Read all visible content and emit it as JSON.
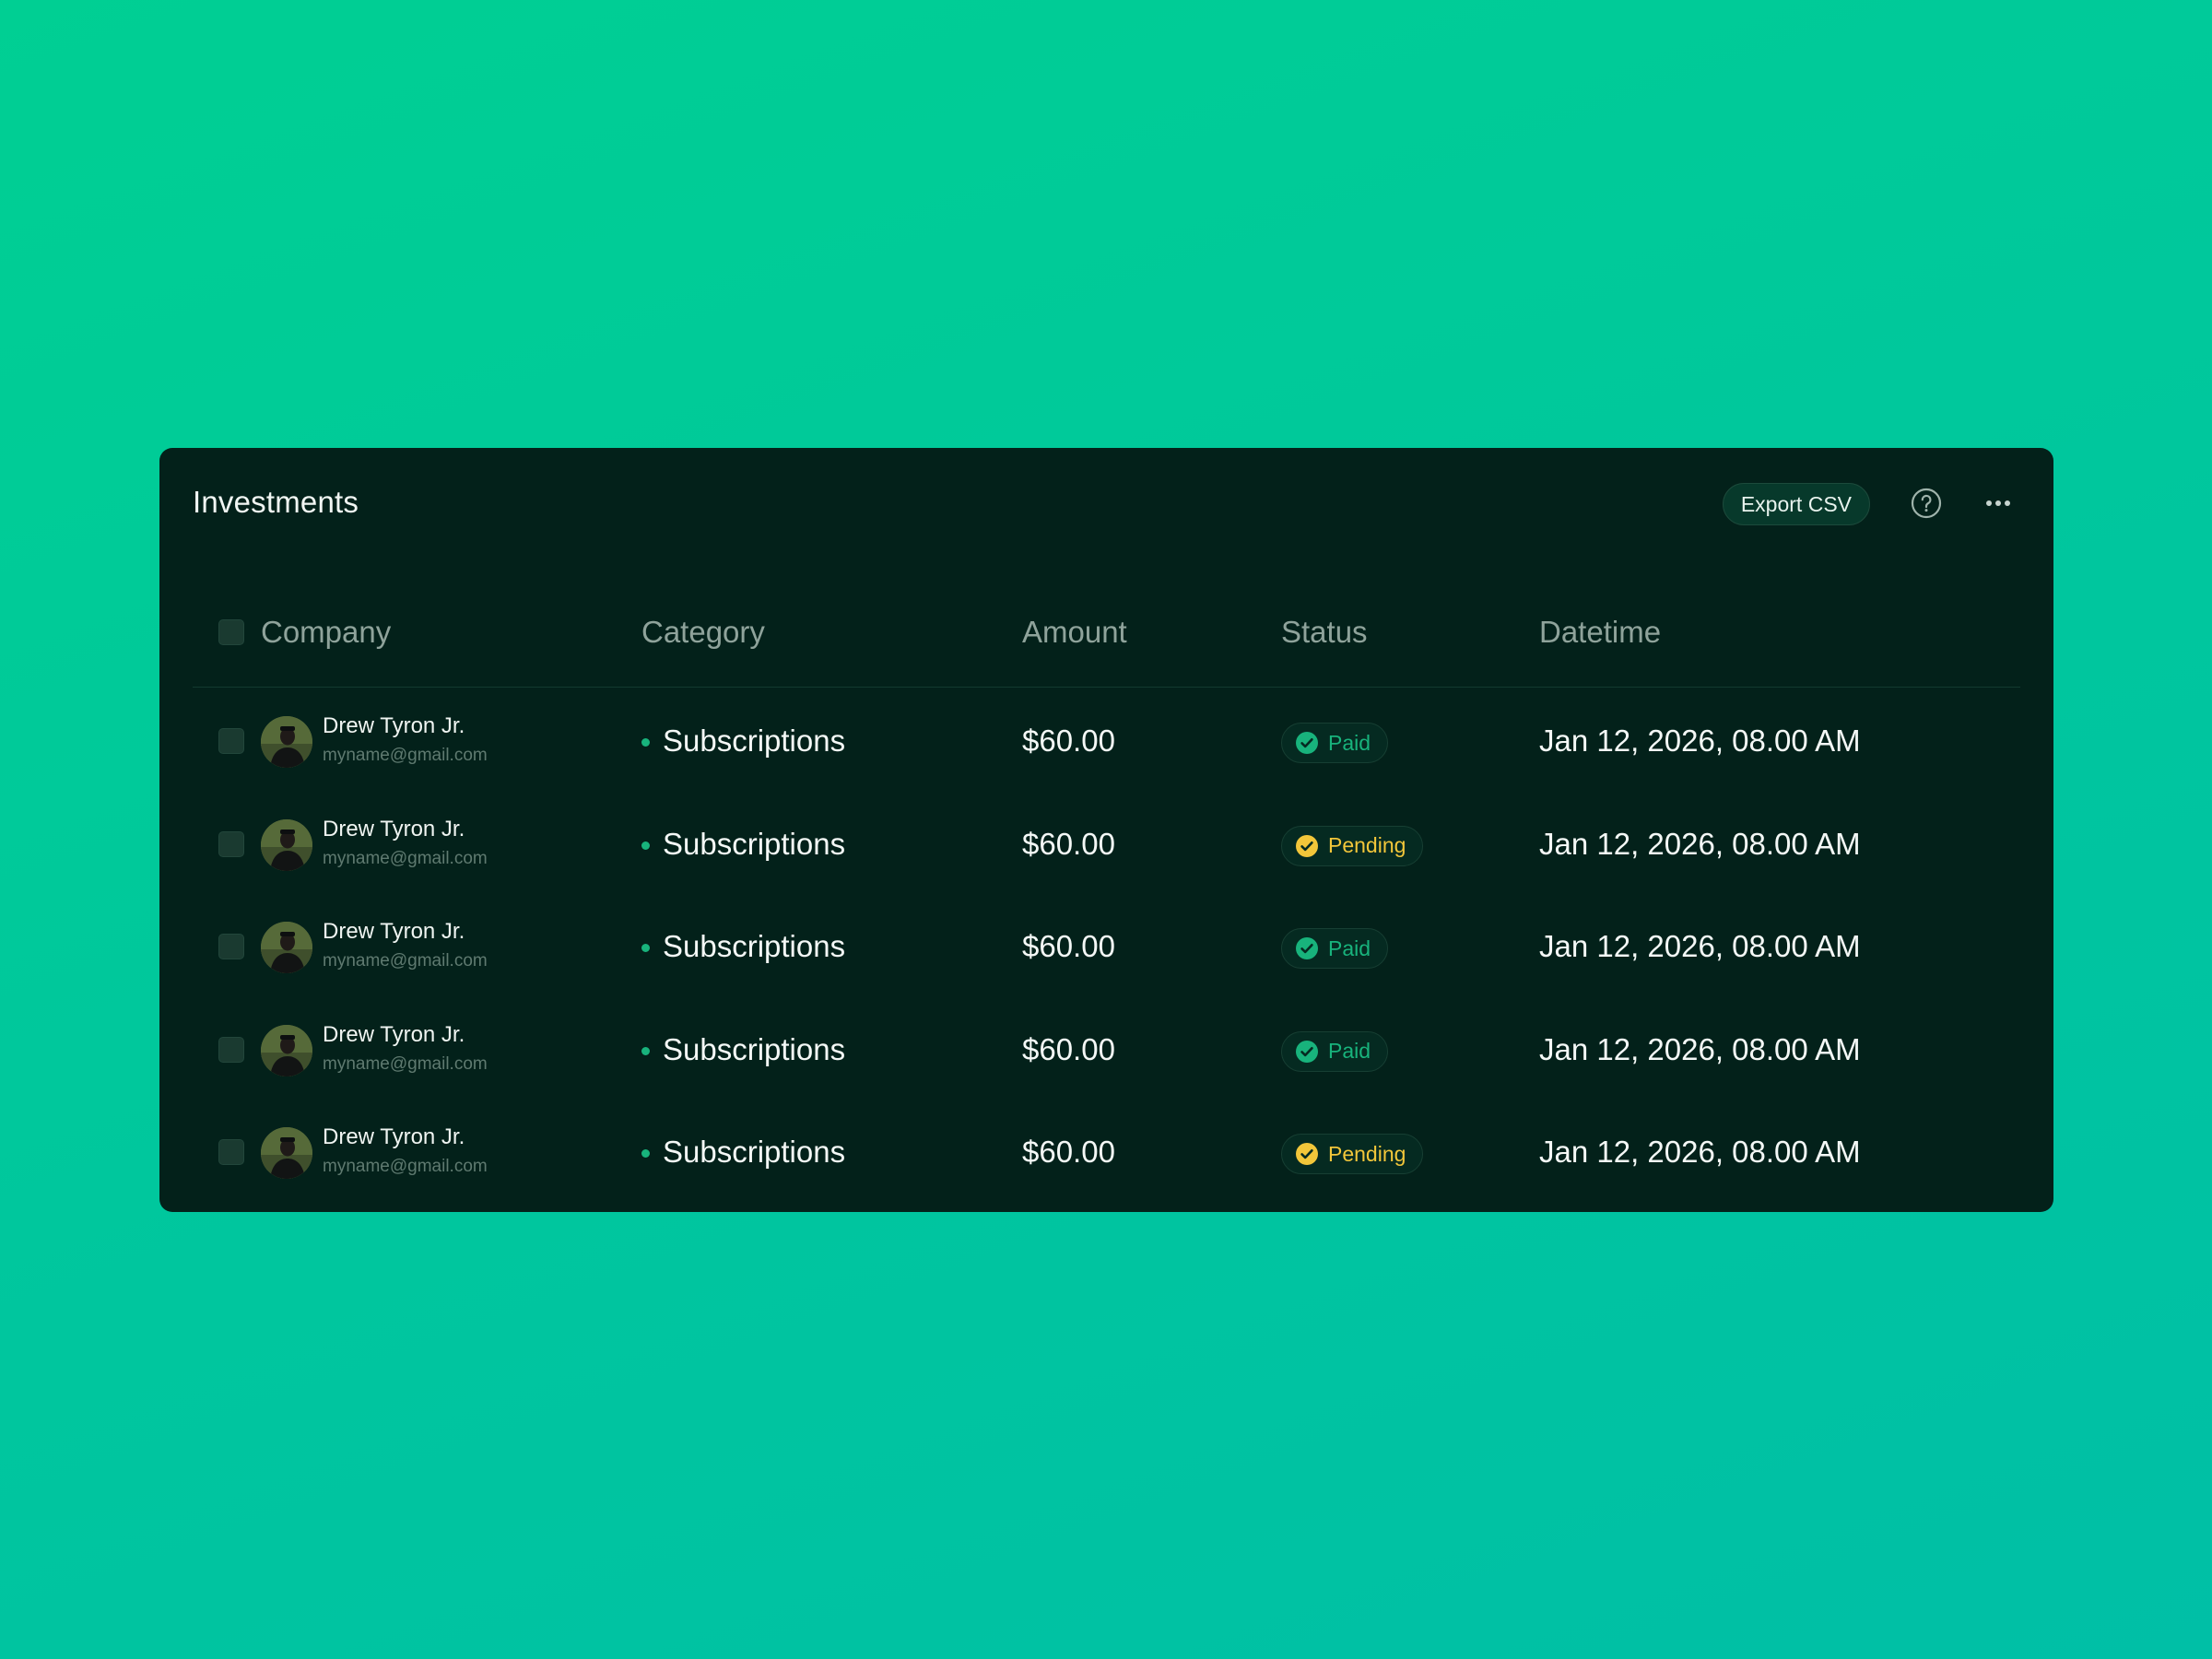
{
  "card": {
    "title": "Investments",
    "export_label": "Export CSV"
  },
  "columns": {
    "company": "Company",
    "category": "Category",
    "amount": "Amount",
    "status": "Status",
    "datetime": "Datetime"
  },
  "colors": {
    "paid": "#18b37c",
    "pending": "#f2c63a",
    "card_bg": "#03211a"
  },
  "icons": [
    "help-circle-icon",
    "more-horizontal-icon",
    "check-circle-icon"
  ],
  "rows": [
    {
      "name": "Drew Tyron Jr.",
      "email": "myname@gmail.com",
      "category": "Subscriptions",
      "amount": "$60.00",
      "status": "Paid",
      "status_kind": "paid",
      "datetime": "Jan 12, 2026, 08.00 AM"
    },
    {
      "name": "Drew Tyron Jr.",
      "email": "myname@gmail.com",
      "category": "Subscriptions",
      "amount": "$60.00",
      "status": "Pending",
      "status_kind": "pending",
      "datetime": "Jan 12, 2026, 08.00 AM"
    },
    {
      "name": "Drew Tyron Jr.",
      "email": "myname@gmail.com",
      "category": "Subscriptions",
      "amount": "$60.00",
      "status": "Paid",
      "status_kind": "paid",
      "datetime": "Jan 12, 2026, 08.00 AM"
    },
    {
      "name": "Drew Tyron Jr.",
      "email": "myname@gmail.com",
      "category": "Subscriptions",
      "amount": "$60.00",
      "status": "Paid",
      "status_kind": "paid",
      "datetime": "Jan 12, 2026, 08.00 AM"
    },
    {
      "name": "Drew Tyron Jr.",
      "email": "myname@gmail.com",
      "category": "Subscriptions",
      "amount": "$60.00",
      "status": "Pending",
      "status_kind": "pending",
      "datetime": "Jan 12, 2026, 08.00 AM"
    }
  ]
}
